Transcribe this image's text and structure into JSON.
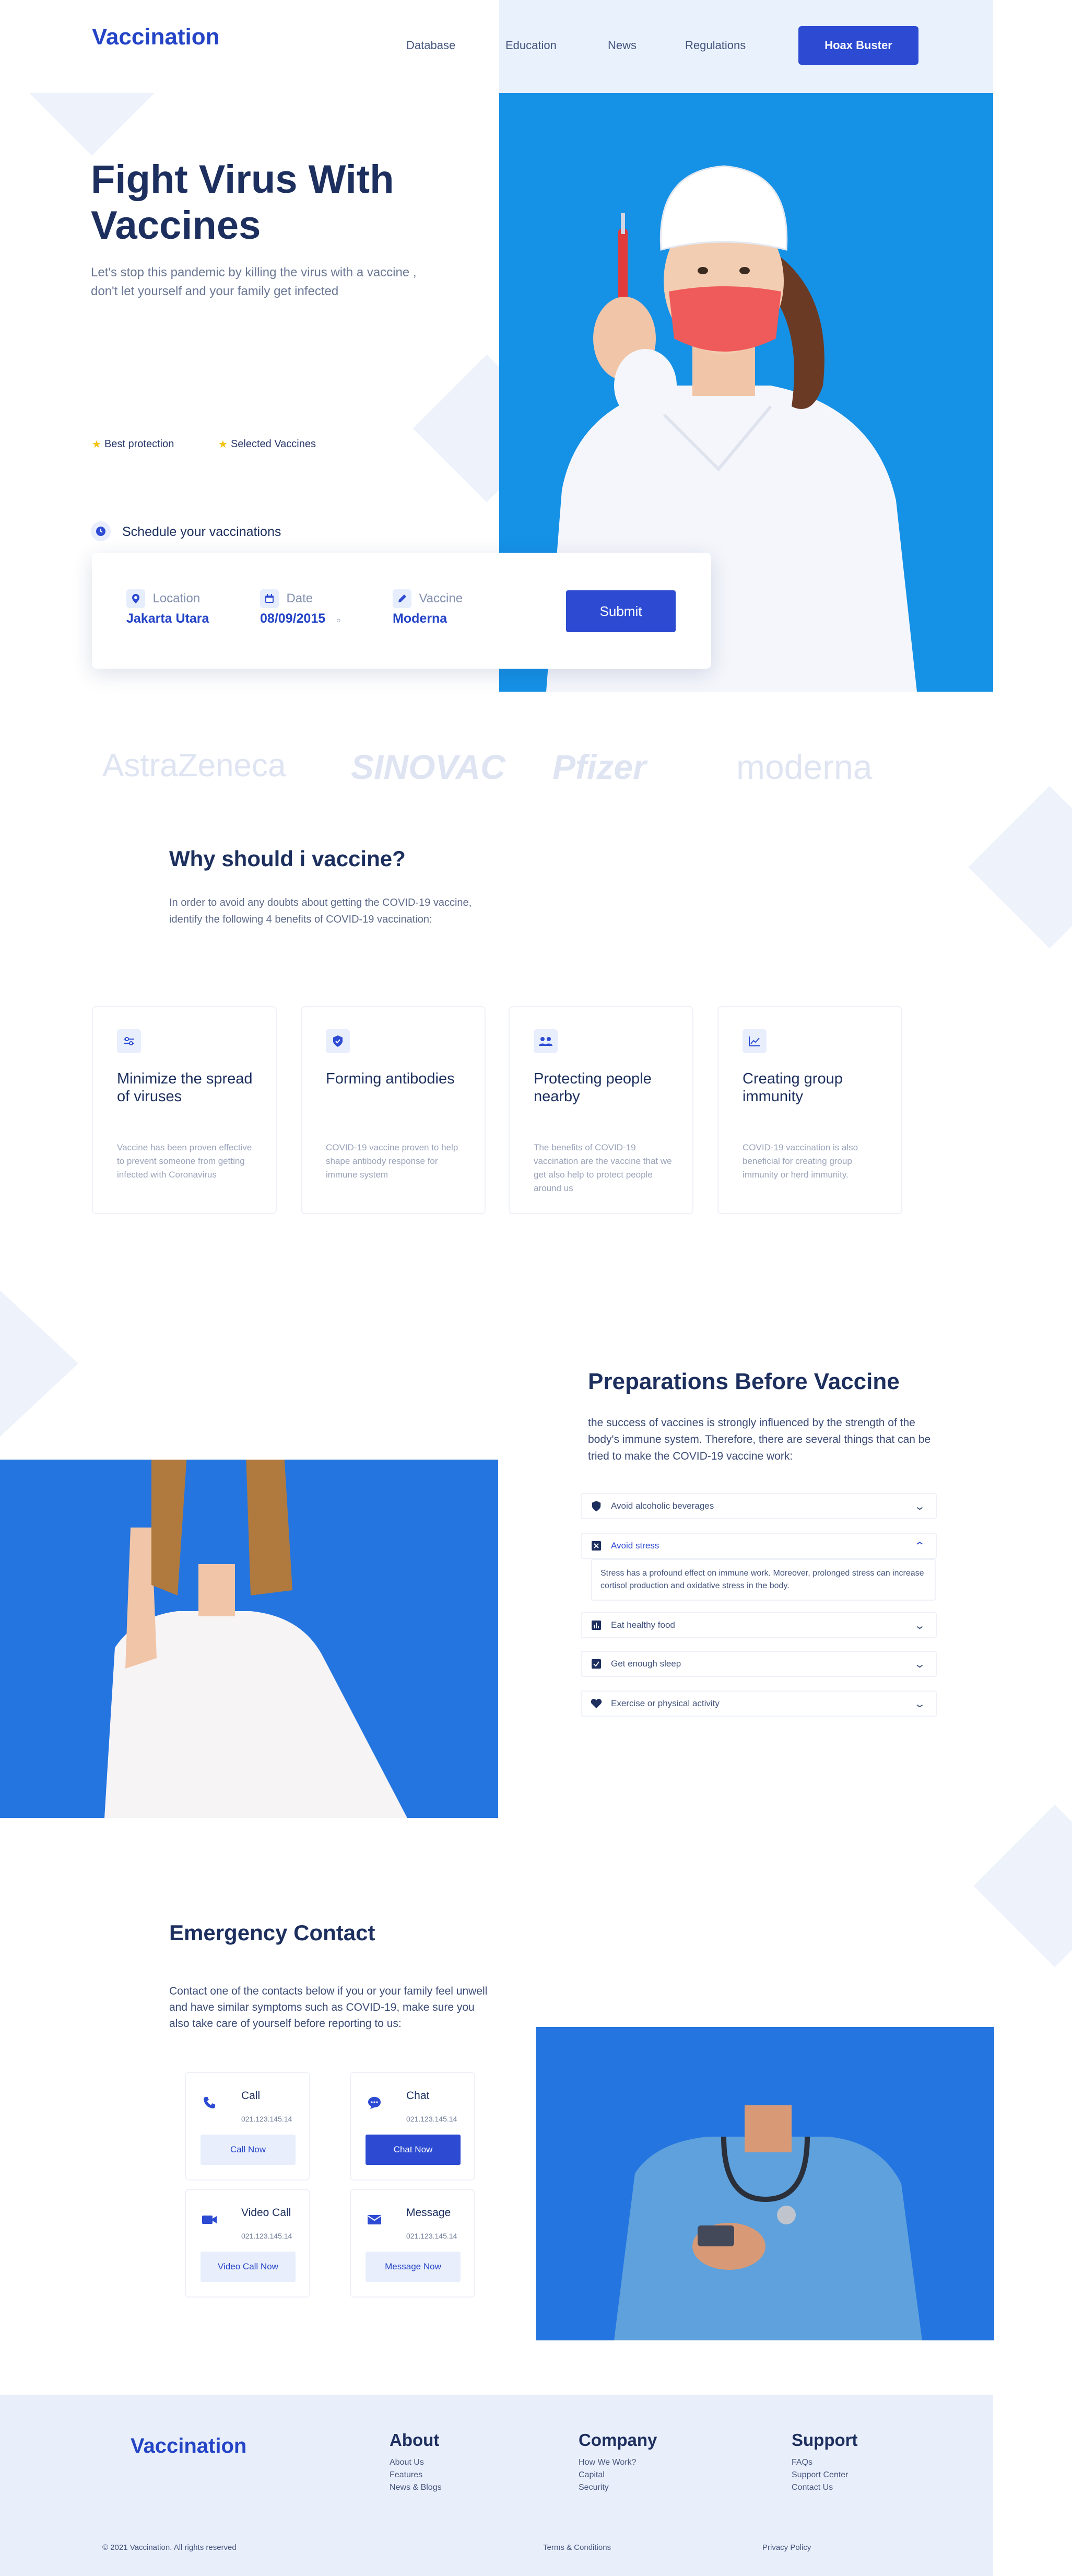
{
  "header": {
    "logo": "Vaccination",
    "nav": [
      "Database",
      "Education",
      "News",
      "Regulations"
    ],
    "cta": "Hoax Buster"
  },
  "hero": {
    "title": "Fight Virus With Vaccines",
    "subtitle": "Let's stop this pandemic by killing the virus with a vaccine , don't let yourself and your family get infected",
    "features": [
      "Best protection",
      "Selected Vaccines"
    ],
    "schedule_label": "Schedule your vaccinations",
    "booking": {
      "location_label": "Location",
      "location_value": "Jakarta Utara",
      "date_label": "Date",
      "date_value": "08/09/2015",
      "vaccine_label": "Vaccine",
      "vaccine_value": "Moderna",
      "submit": "Submit"
    }
  },
  "brands": [
    "AstraZeneca",
    "SINOVAC",
    "Pfizer",
    "moderna"
  ],
  "why": {
    "title": "Why should i vaccine?",
    "text": "In order to avoid any doubts about getting the COVID-19 vaccine, identify the following 4 benefits of COVID-19 vaccination:",
    "cards": [
      {
        "title": "Minimize the spread of viruses",
        "text": "Vaccine has been proven effective to prevent someone from getting infected with Coronavirus",
        "icon": "sliders-icon"
      },
      {
        "title": "Forming antibodies",
        "text": "COVID-19 vaccine proven to help shape antibody response for immune system",
        "icon": "shield-icon"
      },
      {
        "title": "Protecting people nearby",
        "text": "The benefits of COVID-19 vaccination are the vaccine that we get also help to protect people around us",
        "icon": "people-icon"
      },
      {
        "title": "Creating group immunity",
        "text": "COVID-19 vaccination is also beneficial for creating group immunity or herd immunity.",
        "icon": "chart-icon"
      }
    ]
  },
  "preparations": {
    "title": "Preparations Before Vaccine",
    "text": "the success of vaccines is strongly influenced by the strength of the body's immune system. Therefore, there are several things that can be tried to make the COVID-19 vaccine work:",
    "items": [
      {
        "label": "Avoid alcoholic beverages",
        "icon": "shield-icon",
        "chev": "⌄"
      },
      {
        "label": "Avoid stress",
        "icon": "close-box-icon",
        "chev": "⌃"
      },
      {
        "label": "Eat healthy food",
        "icon": "bar-chart-icon",
        "chev": "⌄"
      },
      {
        "label": "Get enough sleep",
        "icon": "check-box-icon",
        "chev": "⌄"
      },
      {
        "label": "Exercise or physical activity",
        "icon": "heart-icon",
        "chev": "⌄"
      }
    ],
    "expanded_text": "Stress has a profound effect on immune work. Moreover, prolonged stress can increase cortisol production and oxidative stress in the body."
  },
  "emergency": {
    "title": "Emergency Contact",
    "text": "Contact one of the contacts below if you or your family feel unwell and have similar symptoms such as COVID-19, make sure you also take care of yourself before reporting to us:",
    "cards": [
      {
        "title": "Call",
        "number": "021.123.145.14",
        "button": "Call Now",
        "icon": "phone-icon"
      },
      {
        "title": "Chat",
        "number": "021.123.145.14",
        "button": "Chat Now",
        "icon": "chat-icon"
      },
      {
        "title": "Video Call",
        "number": "021.123.145.14",
        "button": "Video Call Now",
        "icon": "video-icon"
      },
      {
        "title": "Message",
        "number": "021.123.145.14",
        "button": "Message Now",
        "icon": "mail-icon"
      }
    ]
  },
  "footer": {
    "logo": "Vaccination",
    "about": {
      "title": "About",
      "links": [
        "About Us",
        "Features",
        "News & Blogs"
      ]
    },
    "company": {
      "title": "Company",
      "links": [
        "How We Work?",
        "Capital",
        "Security"
      ]
    },
    "support": {
      "title": "Support",
      "links": [
        "FAQs",
        "Support Center",
        "Contact Us"
      ]
    },
    "copyright": "© 2021 Vaccination. All rights reserved",
    "terms": "Terms & Conditions",
    "privacy": "Privacy Policy"
  },
  "colors": {
    "primary": "#2d4bd2",
    "navy": "#1c2f5e",
    "hero_bg": "#1591e6",
    "photo_bg": "#2475e0",
    "footer_bg": "#e9eefb"
  }
}
